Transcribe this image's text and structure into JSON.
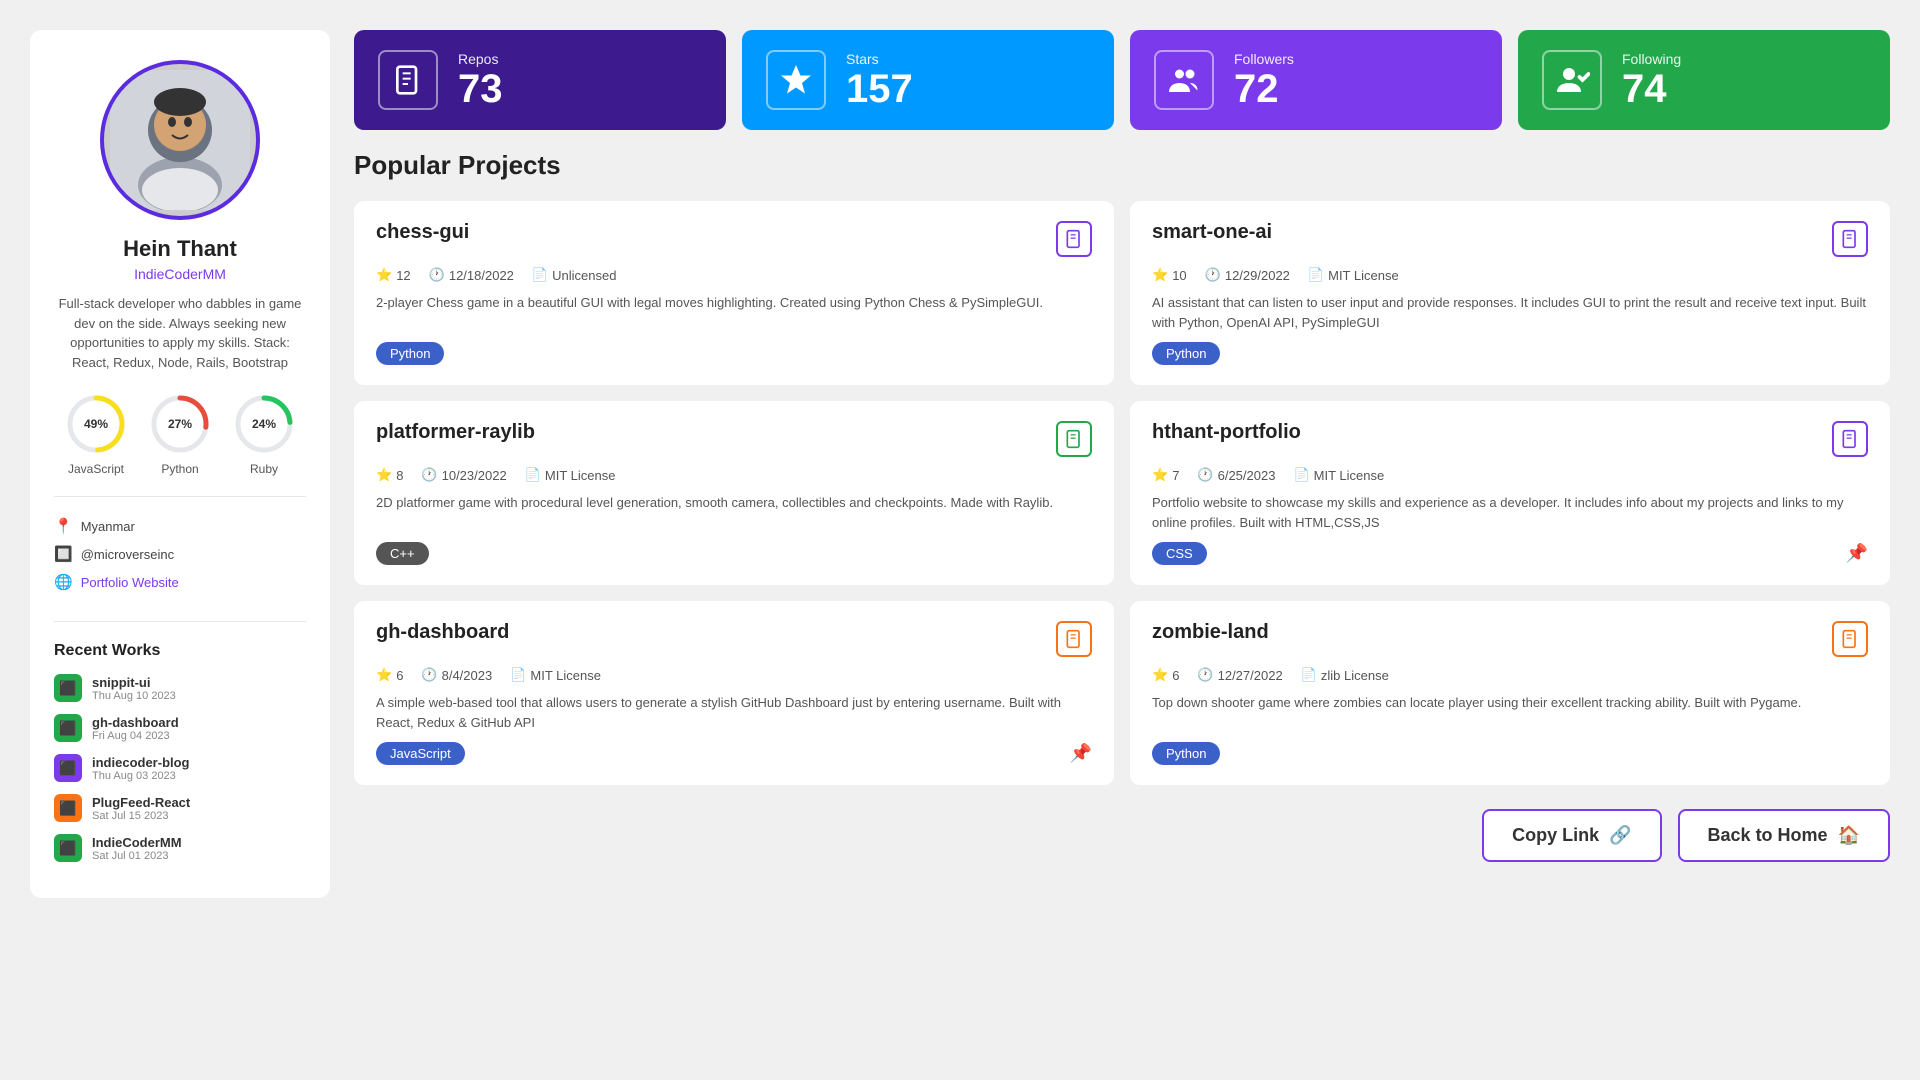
{
  "profile": {
    "name": "Hein Thant",
    "username": "IndieCoderMM",
    "bio": "Full-stack developer who dabbles in game dev on the side. Always seeking new opportunities to apply my skills. Stack: React, Redux, Node, Rails, Bootstrap",
    "location": "Myanmar",
    "twitter": "@microverseinc",
    "website_label": "Portfolio Website",
    "website_url": "#"
  },
  "skills": [
    {
      "label": "JavaScript",
      "pct": 49,
      "color": "#f7df1e",
      "stroke_color": "#f7df1e",
      "circumference": 163,
      "dash": 79.87
    },
    {
      "label": "Python",
      "pct": 27,
      "color": "#e74c3c",
      "stroke_color": "#e74c3c",
      "circumference": 163,
      "dash": 44.01
    },
    {
      "label": "Ruby",
      "pct": 24,
      "color": "#22c55e",
      "stroke_color": "#22c55e",
      "circumference": 163,
      "dash": 39.12
    }
  ],
  "stats": [
    {
      "key": "repos",
      "label": "Repos",
      "value": "73",
      "color_class": "repos",
      "icon": "📋"
    },
    {
      "key": "stars",
      "label": "Stars",
      "value": "157",
      "color_class": "stars",
      "icon": "⭐"
    },
    {
      "key": "followers",
      "label": "Followers",
      "value": "72",
      "color_class": "followers",
      "icon": "👥"
    },
    {
      "key": "following",
      "label": "Following",
      "value": "74",
      "color_class": "following",
      "icon": "👤"
    }
  ],
  "popular_projects_title": "Popular Projects",
  "projects": [
    {
      "name": "chess-gui",
      "stars": "12",
      "date": "12/18/2022",
      "license": "Unlicensed",
      "desc": "2-player Chess game in a beautiful GUI with legal moves highlighting. Created using Python Chess & PySimpleGUI.",
      "lang": "Python",
      "lang_class": "lang-python",
      "icon_color": "#7c3aed",
      "pinned": false
    },
    {
      "name": "smart-one-ai",
      "stars": "10",
      "date": "12/29/2022",
      "license": "MIT License",
      "desc": "AI assistant that can listen to user input and provide responses. It includes GUI to print the result and receive text input. Built with Python, OpenAI API, PySimpleGUI",
      "lang": "Python",
      "lang_class": "lang-python",
      "icon_color": "#7c3aed",
      "pinned": false
    },
    {
      "name": "platformer-raylib",
      "stars": "8",
      "date": "10/23/2022",
      "license": "MIT License",
      "desc": "2D platformer game with procedural level generation, smooth camera, collectibles and checkpoints. Made with Raylib.",
      "lang": "C++",
      "lang_class": "lang-cpp",
      "icon_color": "#22a84a",
      "pinned": false
    },
    {
      "name": "hthant-portfolio",
      "stars": "7",
      "date": "6/25/2023",
      "license": "MIT License",
      "desc": "Portfolio website to showcase my skills and experience as a developer. It includes info about my projects and links to my online profiles. Built with HTML,CSS,JS",
      "lang": "CSS",
      "lang_class": "lang-css",
      "icon_color": "#7c3aed",
      "pinned": true
    },
    {
      "name": "gh-dashboard",
      "stars": "6",
      "date": "8/4/2023",
      "license": "MIT License",
      "desc": "A simple web-based tool that allows users to generate a stylish GitHub Dashboard just by entering username. Built with React, Redux & GitHub API",
      "lang": "JavaScript",
      "lang_class": "lang-javascript",
      "icon_color": "#f97316",
      "pinned": true
    },
    {
      "name": "zombie-land",
      "stars": "6",
      "date": "12/27/2022",
      "license": "zlib License",
      "desc": "Top down shooter game where zombies can locate player using their excellent tracking ability. Built with Pygame.",
      "lang": "Python",
      "lang_class": "lang-python",
      "icon_color": "#f97316",
      "pinned": false
    }
  ],
  "recent_works_title": "Recent Works",
  "recent_works": [
    {
      "name": "snippit-ui",
      "date": "Thu Aug 10 2023",
      "color": "#22a84a"
    },
    {
      "name": "gh-dashboard",
      "date": "Fri Aug 04 2023",
      "color": "#22a84a"
    },
    {
      "name": "indiecoder-blog",
      "date": "Thu Aug 03 2023",
      "color": "#7c3aed"
    },
    {
      "name": "PlugFeed-React",
      "date": "Sat Jul 15 2023",
      "color": "#f97316"
    },
    {
      "name": "IndieCoderMM",
      "date": "Sat Jul 01 2023",
      "color": "#22a84a"
    }
  ],
  "buttons": {
    "copy_link": "Copy Link",
    "back_to_home": "Back to Home"
  }
}
